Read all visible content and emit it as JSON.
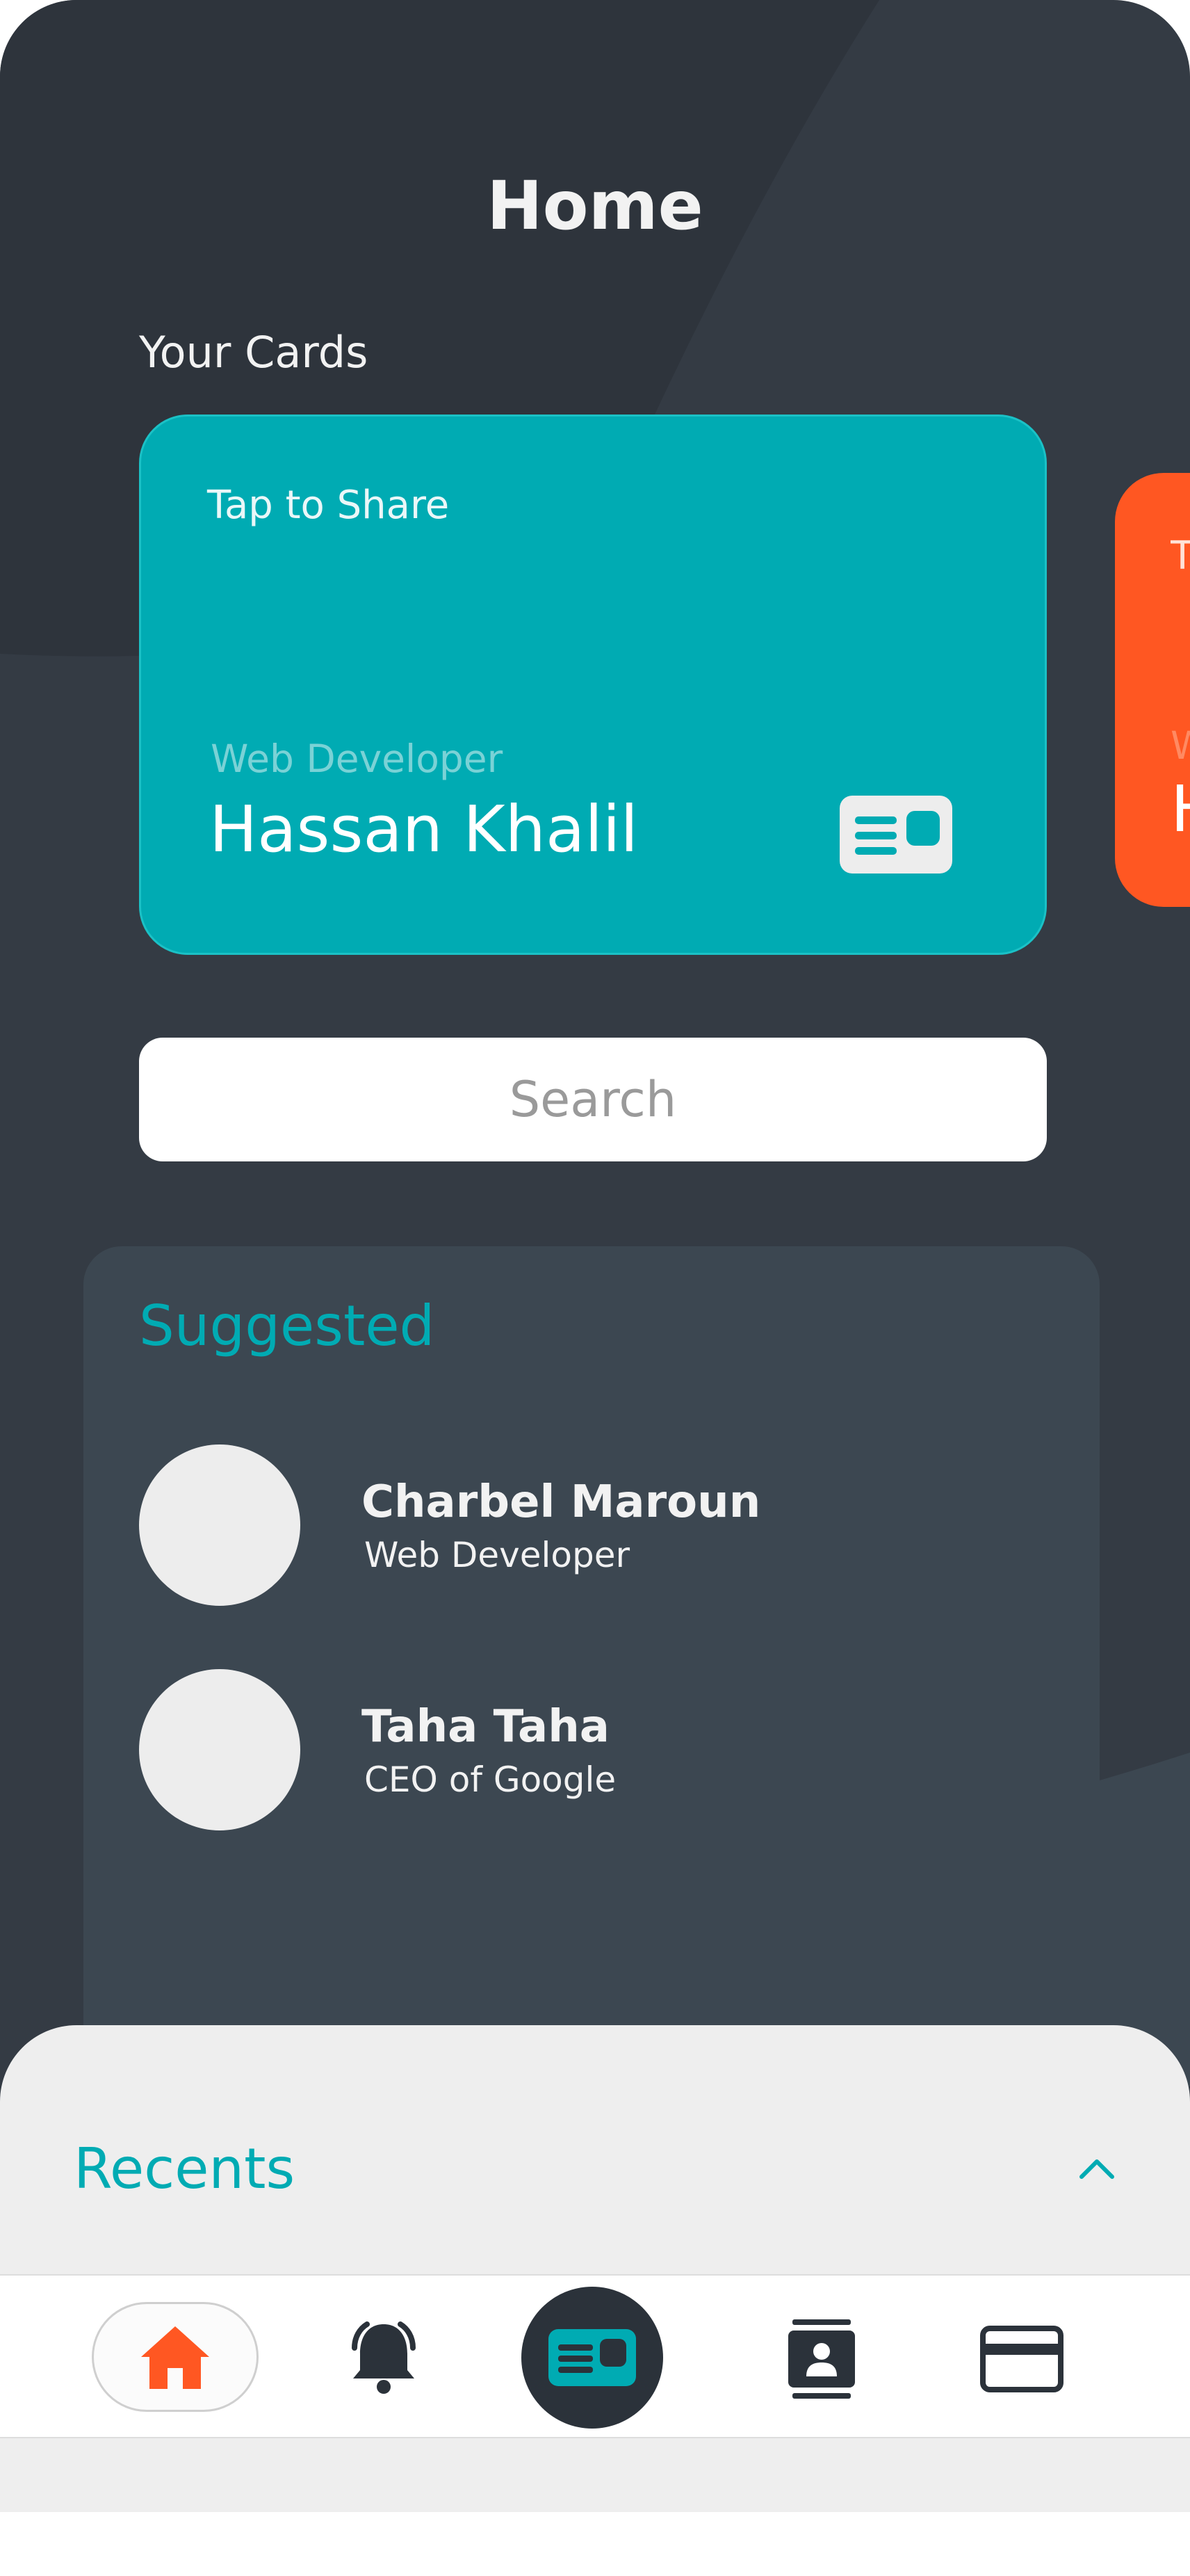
{
  "header": {
    "title": "Home"
  },
  "cards_section": {
    "label": "Your Cards"
  },
  "cards": [
    {
      "tap_label": "Tap to Share",
      "role": "Web Developer",
      "name": "Hassan Khalil",
      "color": "#00abb3"
    },
    {
      "tap_label": "Tap to Share",
      "role": "Web Developer",
      "name": "Hassan Khalil",
      "color": "#ff5722"
    }
  ],
  "search": {
    "placeholder": "Search"
  },
  "suggested": {
    "title": "Suggested",
    "people": [
      {
        "name": "Charbel Maroun",
        "role": "Web Developer"
      },
      {
        "name": "Taha Taha",
        "role": "CEO of Google"
      }
    ]
  },
  "recents": {
    "title": "Recents"
  },
  "bottom_nav": {
    "items": [
      {
        "icon": "home-icon",
        "active": true
      },
      {
        "icon": "bell-icon",
        "active": false
      },
      {
        "icon": "card-icon",
        "active": false
      },
      {
        "icon": "contacts-icon",
        "active": false
      },
      {
        "icon": "credit-card-icon",
        "active": false
      }
    ]
  },
  "colors": {
    "accent": "#00abb3",
    "orange": "#ff5722",
    "background": "#343b44",
    "panel": "#3c4751"
  }
}
